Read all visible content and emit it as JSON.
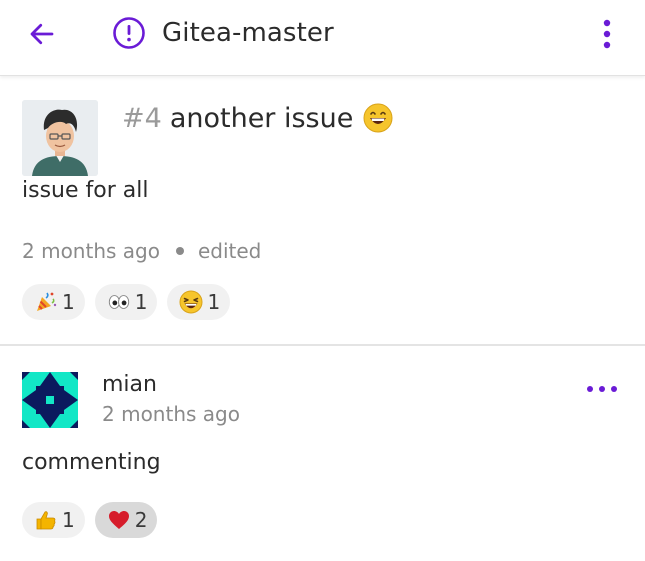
{
  "appbar": {
    "title": "Gitea-master",
    "back_icon": "arrow-left-icon",
    "issue_icon": "issue-open-icon",
    "menu_icon": "more-vertical-icon",
    "accent_color": "#6a1bd6"
  },
  "issue": {
    "number": "#4",
    "title": "another issue",
    "title_emoji": "grinning-face-icon",
    "body": "issue for all",
    "time": "2 months ago",
    "edited": "edited",
    "reactions": [
      {
        "icon": "party-popper-icon",
        "count": "1"
      },
      {
        "icon": "eyes-icon",
        "count": "1"
      },
      {
        "icon": "laughing-face-icon",
        "count": "1"
      }
    ]
  },
  "comment": {
    "author": "mian",
    "time": "2 months ago",
    "body": "commenting",
    "menu_icon": "more-horizontal-icon",
    "reactions": [
      {
        "icon": "thumbs-up-icon",
        "count": "1"
      },
      {
        "icon": "red-heart-icon",
        "count": "2"
      }
    ]
  }
}
